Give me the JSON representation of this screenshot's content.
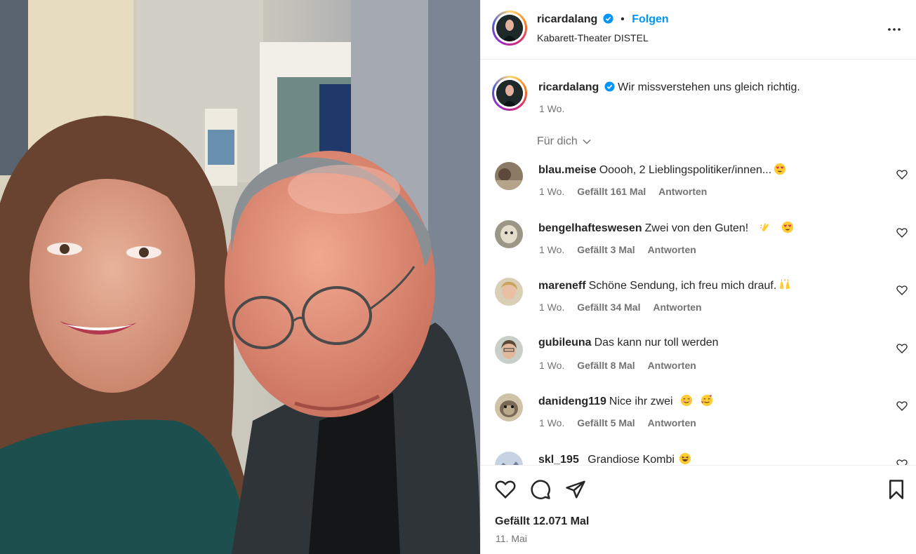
{
  "post": {
    "username": "ricardalang",
    "follow_label": "Folgen",
    "separator": "•",
    "location": "Kabarett-Theater DISTEL",
    "caption": "Wir missverstehen uns gleich richtig.",
    "caption_time": "1 Wo.",
    "likes": "Gefällt 12.071 Mal",
    "date": "11. Mai"
  },
  "sort_label": "Für dich",
  "comments": [
    {
      "user": "blau.meise",
      "text": "Ooooh, 2 Lieblingspolitiker/innen...",
      "time": "1 Wo.",
      "likes": "Gefällt 161 Mal",
      "reply": "Antworten",
      "emojis": [
        "heart-eyes"
      ]
    },
    {
      "user": "bengelhafteswesen",
      "text": "Zwei von den Guten!",
      "time": "1 Wo.",
      "likes": "Gefällt 3 Mal",
      "reply": "Antworten",
      "emojis": [
        "clap",
        "heart-eyes"
      ]
    },
    {
      "user": "mareneff",
      "text": "Schöne Sendung, ich freu mich drauf.",
      "time": "1 Wo.",
      "likes": "Gefällt 34 Mal",
      "reply": "Antworten",
      "emojis": [
        "raised-hands"
      ]
    },
    {
      "user": "gubileuna",
      "text": "Das kann nur toll werden",
      "time": "1 Wo.",
      "likes": "Gefällt 8 Mal",
      "reply": "Antworten",
      "emojis": []
    },
    {
      "user": "danideng119",
      "text": "Nice ihr zwei",
      "time": "1 Wo.",
      "likes": "Gefällt 5 Mal",
      "reply": "Antworten",
      "emojis": [
        "smiling",
        "hearts-face"
      ]
    },
    {
      "user": "skl_195",
      "text": "Grandiose Kombi",
      "time": "",
      "likes": "",
      "reply": "",
      "emojis": [
        "laughing"
      ]
    }
  ],
  "colors": {
    "accent": "#0095f6",
    "secondary_text": "#737373",
    "border": "#efefef"
  }
}
